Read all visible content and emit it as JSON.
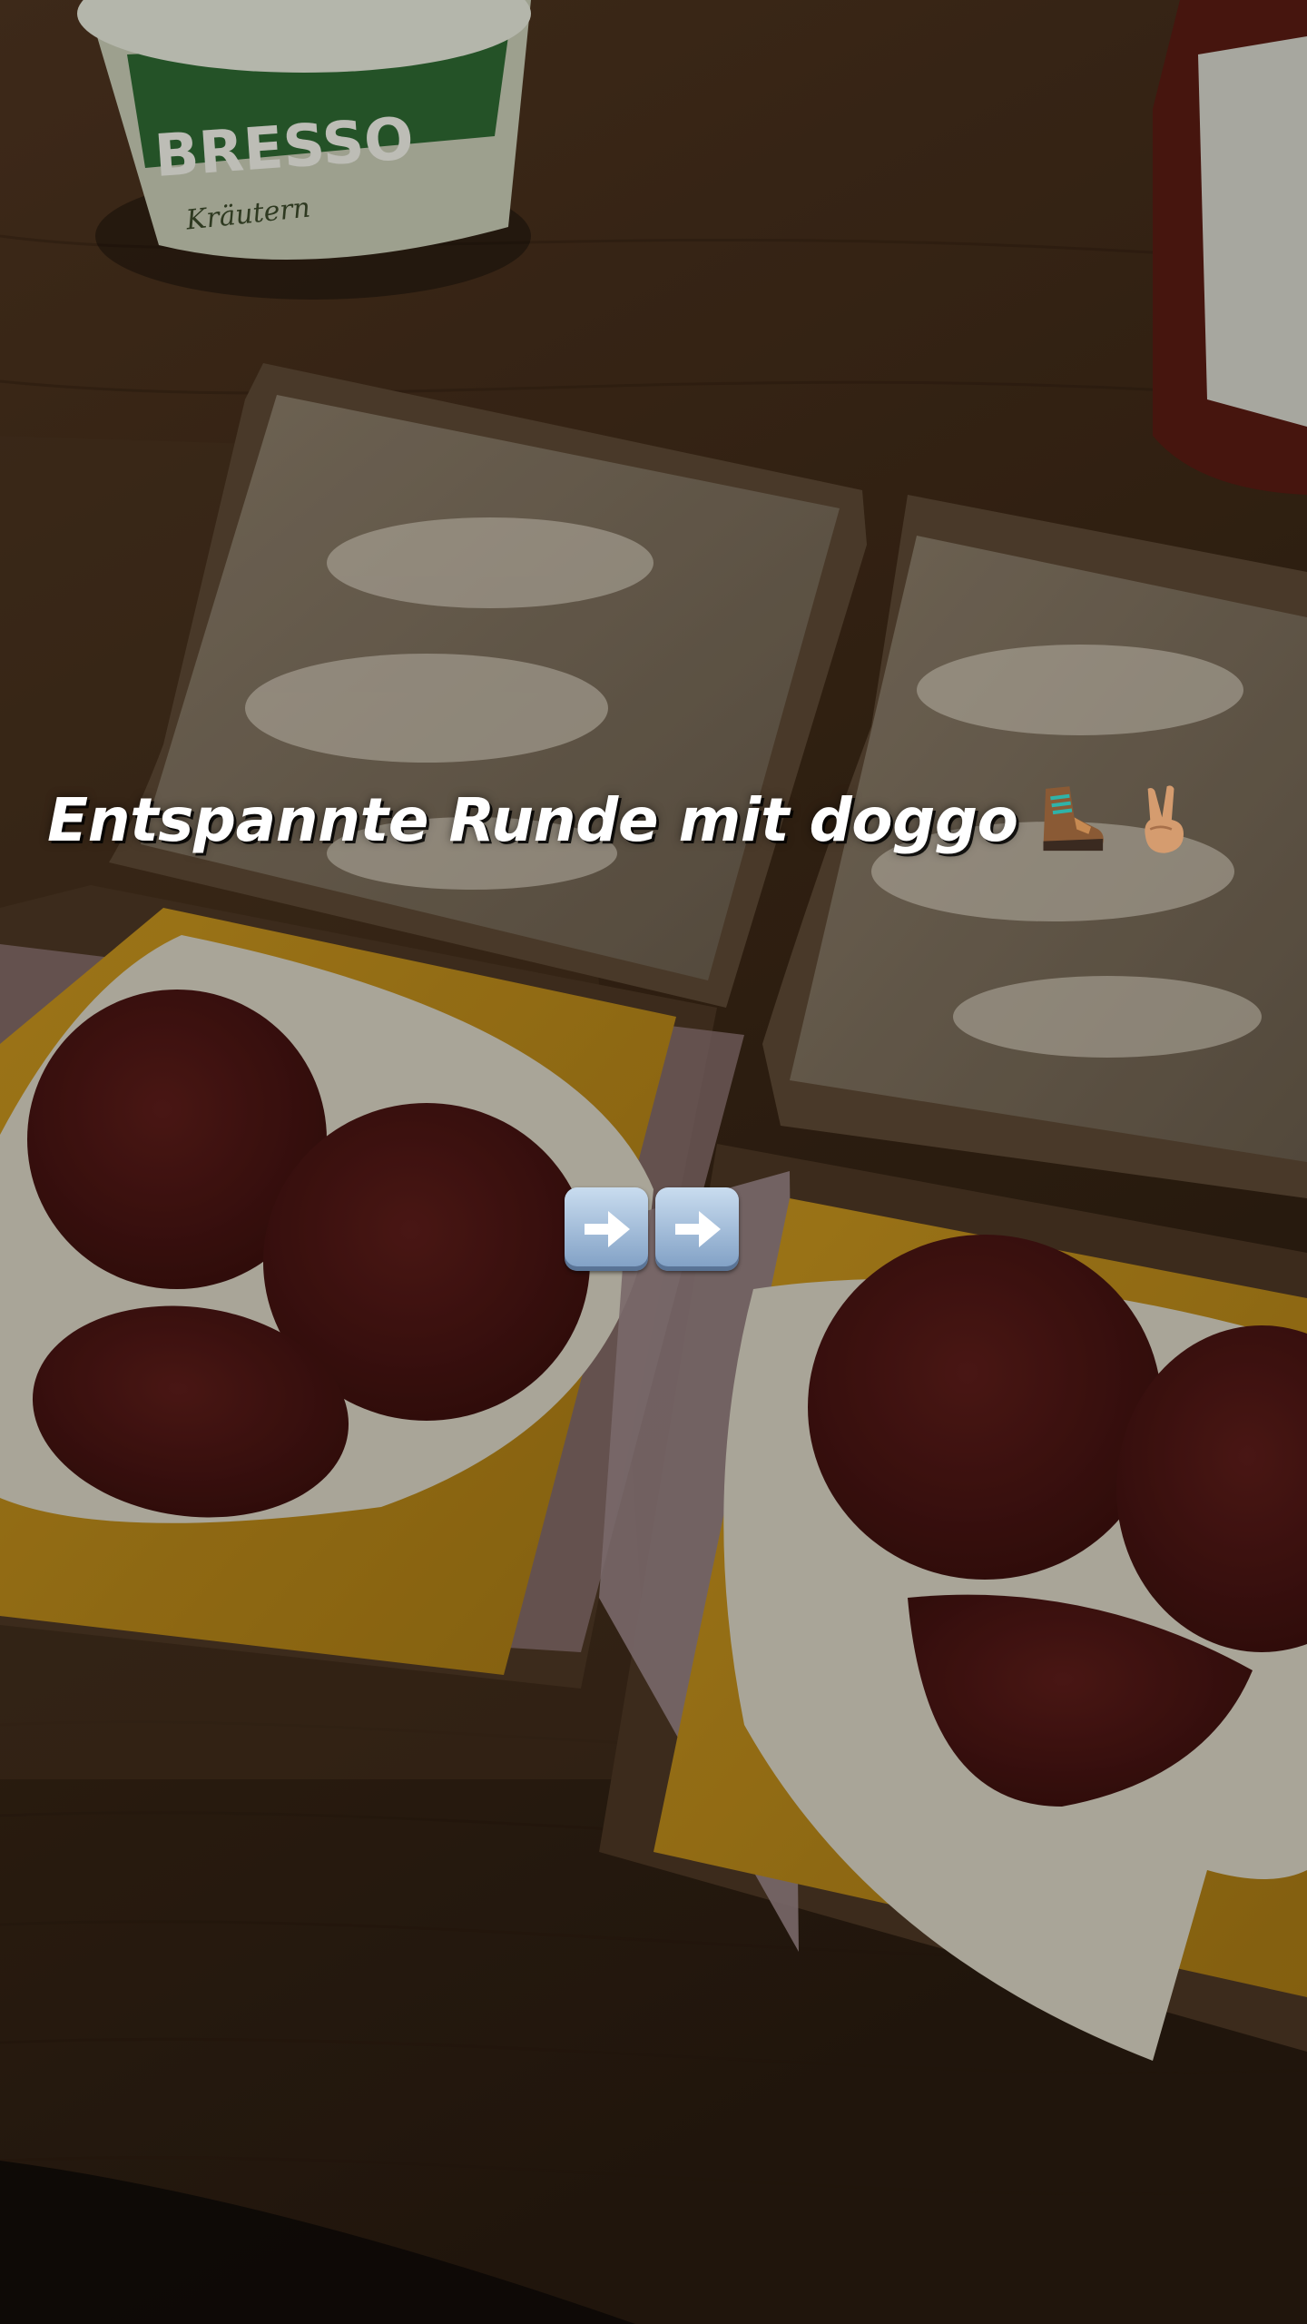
{
  "story": {
    "caption": "Entspannte Runde mit doggo",
    "caption_icons": [
      "hiking-boot-icon",
      "victory-hand-icon"
    ],
    "sticker_icons": [
      "right-arrow-icon",
      "right-arrow-icon"
    ],
    "background_labels": {
      "cream_cheese_brand": "BRESSO",
      "cream_cheese_flavor": "Kräutern"
    }
  }
}
